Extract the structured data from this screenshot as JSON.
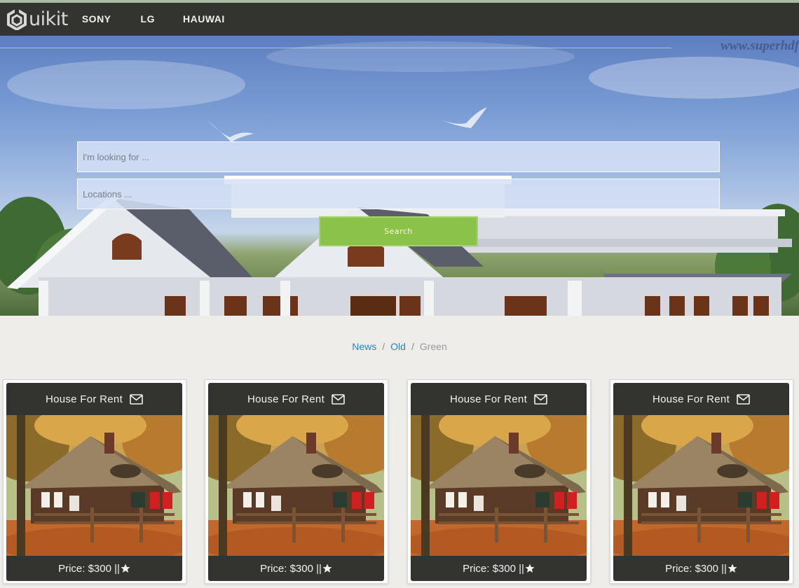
{
  "navbar": {
    "brand": "uikit",
    "items": [
      {
        "label": "SONY"
      },
      {
        "label": "LG"
      },
      {
        "label": "HAUWAI"
      }
    ]
  },
  "hero": {
    "watermark": "www.superhdf",
    "search_placeholder": "I'm looking for ...",
    "location_placeholder": "Locations ...",
    "search_button": "Search"
  },
  "breadcrumb": {
    "items": [
      {
        "label": "News"
      },
      {
        "label": "Old"
      },
      {
        "label": "Green"
      }
    ],
    "separator": "/"
  },
  "listings": [
    {
      "title": "House For Rent",
      "price_label": "Price: $300 ||"
    },
    {
      "title": "House For Rent",
      "price_label": "Price: $300 ||"
    },
    {
      "title": "House For Rent",
      "price_label": "Price: $300 ||"
    },
    {
      "title": "House For Rent",
      "price_label": "Price: $300 ||"
    }
  ],
  "icons": {
    "card_header": "mail-icon",
    "card_footer": "star-icon",
    "brand": "uikit-logo-icon"
  },
  "colors": {
    "navbar": "#33332f",
    "search_button": "#8bc34a",
    "link": "#1e87d0",
    "page_background": "#eeede9"
  }
}
